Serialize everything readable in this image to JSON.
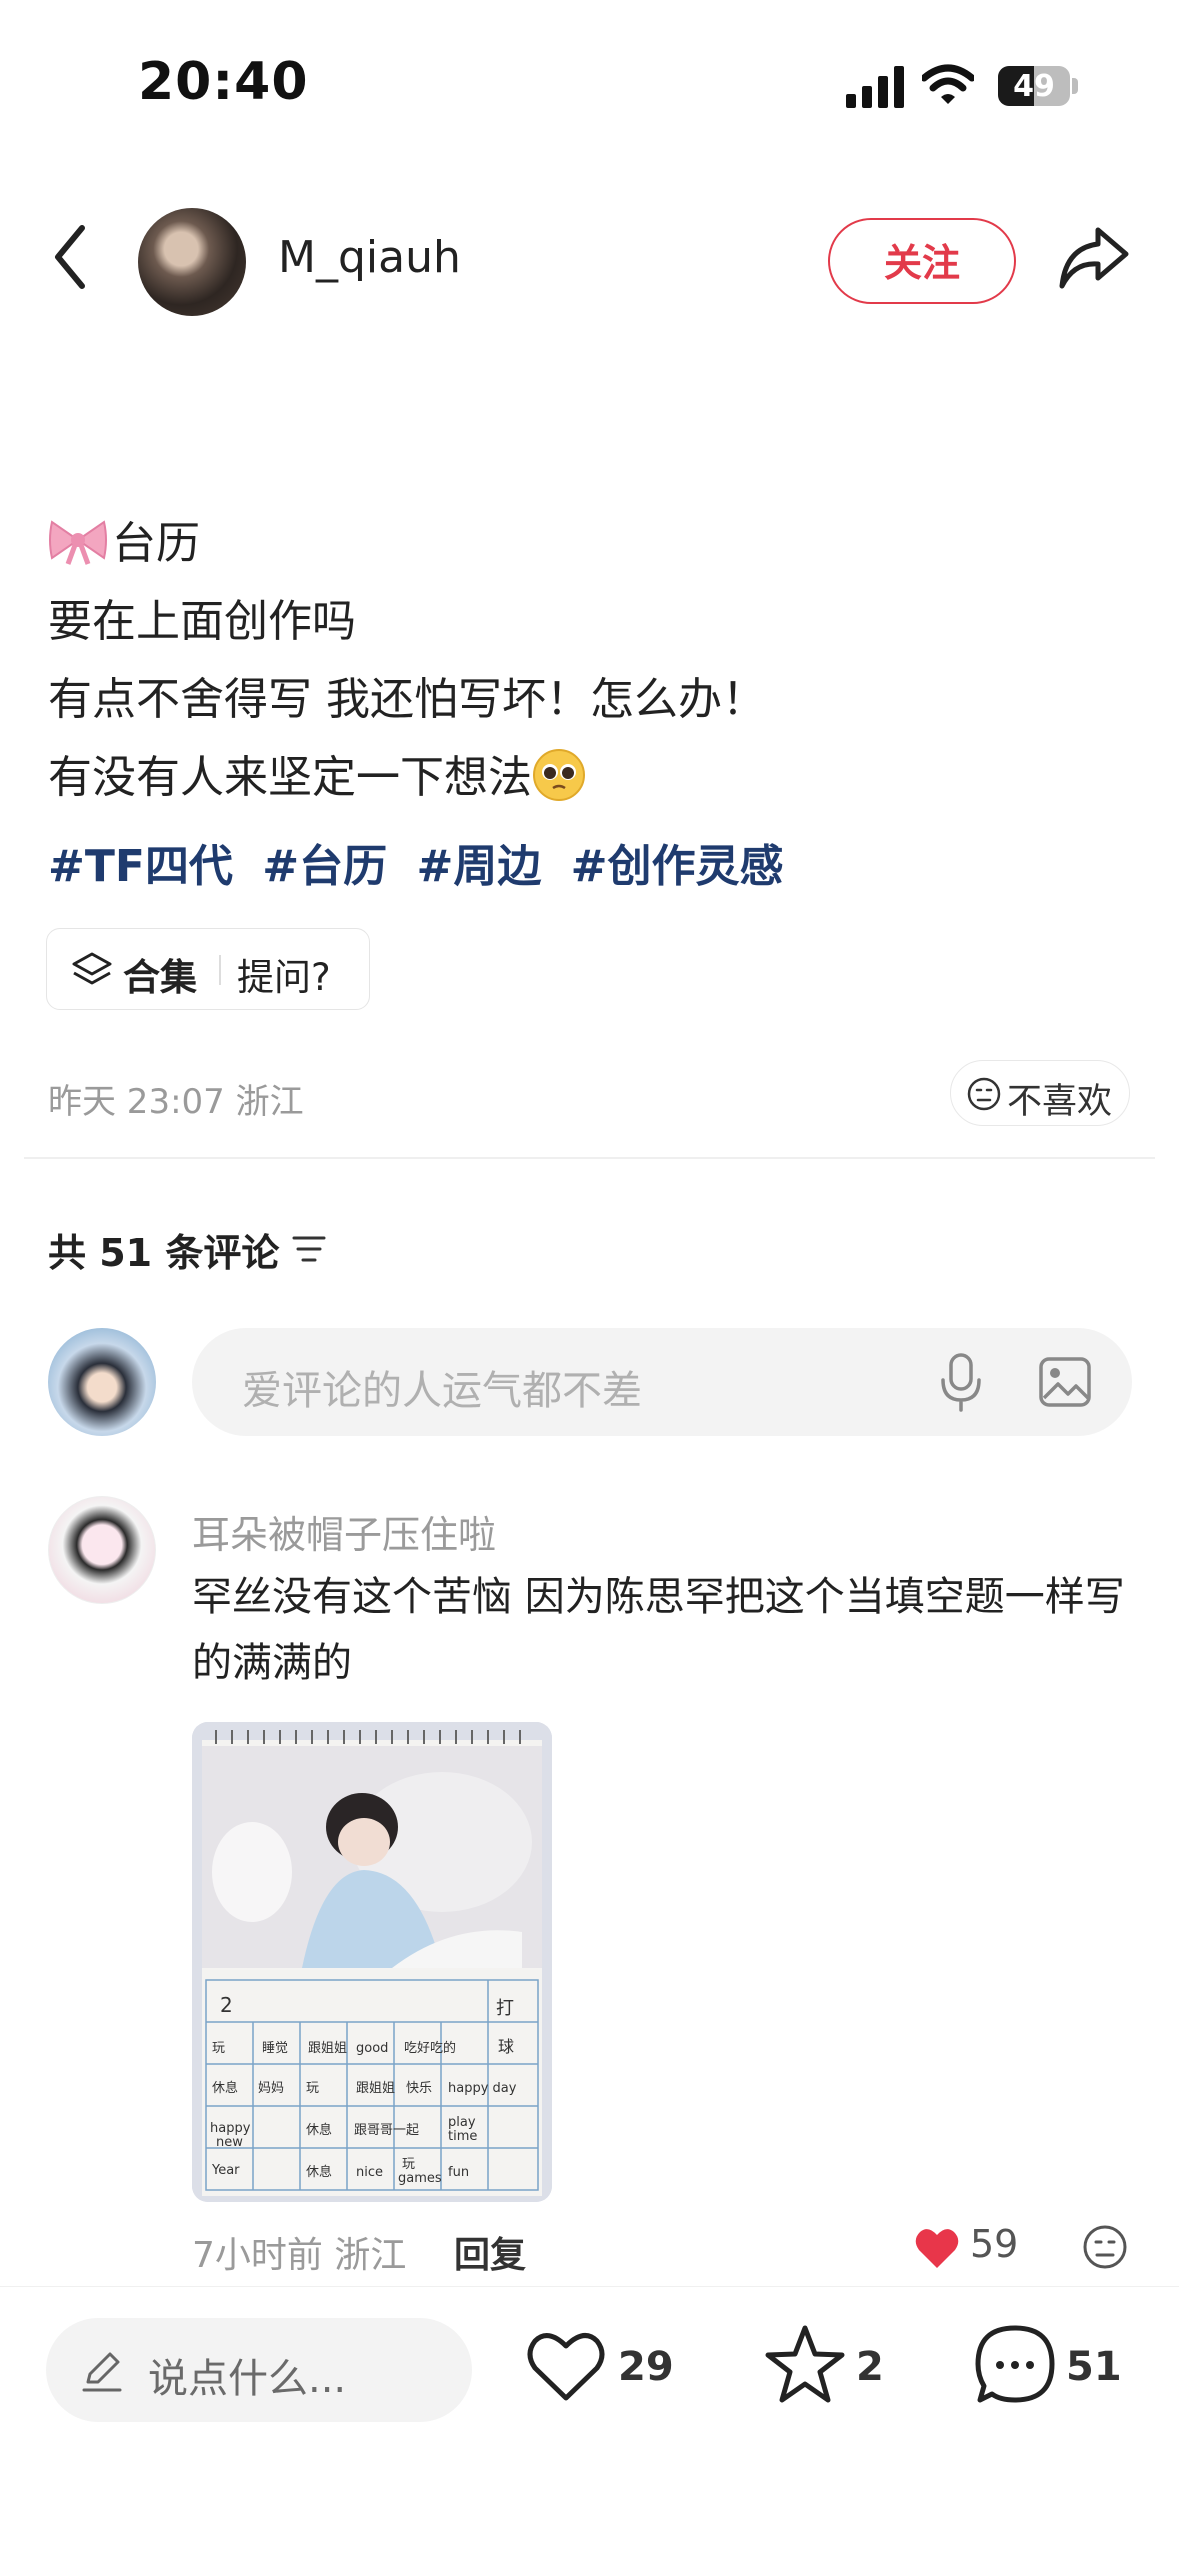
{
  "status_bar": {
    "time": "20:40",
    "battery": "49"
  },
  "header": {
    "author": "M_qiauh",
    "follow_label": "关注"
  },
  "post": {
    "lines": [
      "台历",
      "要在上面创作吗",
      "有点不舍得写 我还怕写坏！怎么办！",
      "有没有人来坚定一下想法"
    ],
    "tags": [
      "#TF四代",
      "#台历",
      "#周边",
      "#创作灵感"
    ],
    "chip": {
      "collection": "合集",
      "question": "提问?"
    },
    "meta": "昨天 23:07 浙江",
    "dislike": "不喜欢"
  },
  "comments": {
    "count_label": "共 51 条评论",
    "input_placeholder": "爱评论的人运气都不差",
    "items": [
      {
        "name": "耳朵被帽子压住啦",
        "text": "罕丝没有这个苦恼 因为陈思罕把这个当填空题一样写的满满的",
        "meta": "7小时前 浙江",
        "reply": "回复",
        "likes": "59"
      }
    ]
  },
  "bottom_bar": {
    "placeholder": "说点什么...",
    "likes": "29",
    "stars": "2",
    "comments": "51"
  },
  "colors": {
    "accent_red": "#e23a4a",
    "tag_blue": "#1f3b6e"
  },
  "icons": [
    "signal-icon",
    "wifi-icon",
    "battery-icon",
    "back-icon",
    "share-icon",
    "bow-emoji",
    "pleading-face-emoji",
    "layers-icon",
    "neutral-face-icon",
    "sort-icon",
    "mic-icon",
    "image-icon",
    "heart-icon",
    "pen-icon",
    "star-icon",
    "comment-icon"
  ]
}
